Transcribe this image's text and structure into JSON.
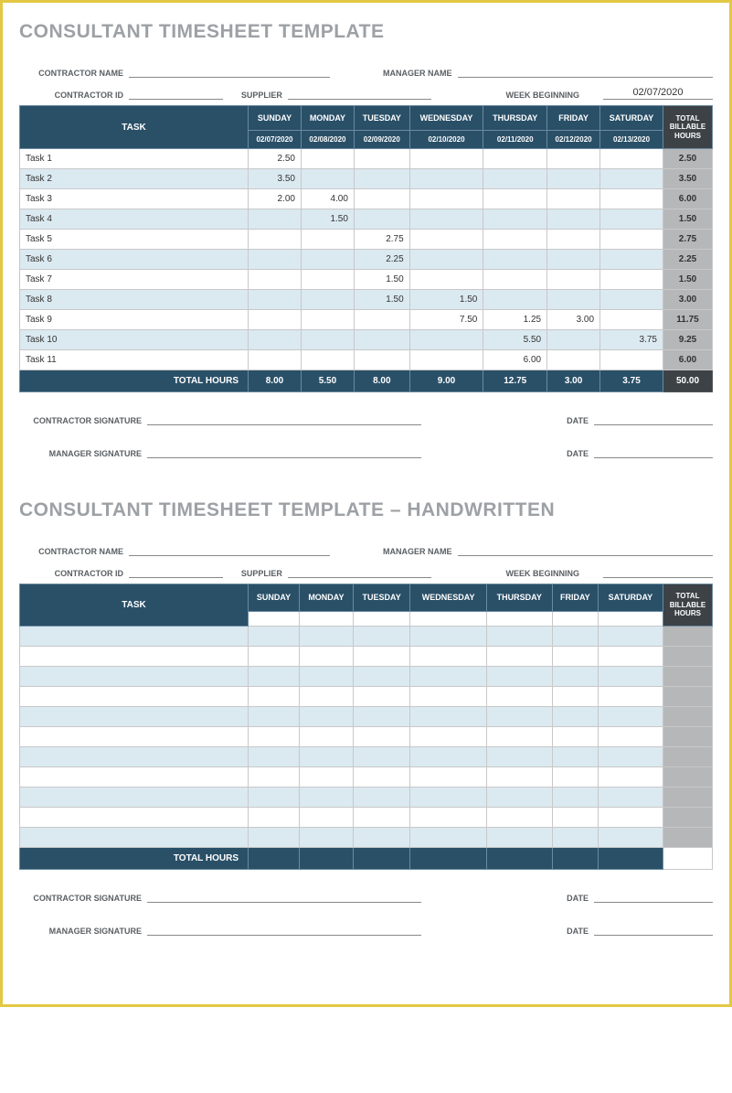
{
  "section1": {
    "title": "CONSULTANT TIMESHEET TEMPLATE",
    "labels": {
      "contractor_name": "CONTRACTOR NAME",
      "manager_name": "MANAGER NAME",
      "contractor_id": "CONTRACTOR ID",
      "supplier": "SUPPLIER",
      "week_beginning": "WEEK BEGINNING",
      "week_beginning_value": "02/07/2020",
      "contractor_signature": "CONTRACTOR SIGNATURE",
      "manager_signature": "MANAGER SIGNATURE",
      "date": "DATE"
    },
    "headers": {
      "task": "TASK",
      "days": [
        "SUNDAY",
        "MONDAY",
        "TUESDAY",
        "WEDNESDAY",
        "THURSDAY",
        "FRIDAY",
        "SATURDAY"
      ],
      "dates": [
        "02/07/2020",
        "02/08/2020",
        "02/09/2020",
        "02/10/2020",
        "02/11/2020",
        "02/12/2020",
        "02/13/2020"
      ],
      "total": "TOTAL BILLABLE HOURS"
    },
    "rows": [
      {
        "task": "Task 1",
        "vals": [
          "2.50",
          "",
          "",
          "",
          "",
          "",
          ""
        ],
        "total": "2.50"
      },
      {
        "task": "Task 2",
        "vals": [
          "3.50",
          "",
          "",
          "",
          "",
          "",
          ""
        ],
        "total": "3.50"
      },
      {
        "task": "Task 3",
        "vals": [
          "2.00",
          "4.00",
          "",
          "",
          "",
          "",
          ""
        ],
        "total": "6.00"
      },
      {
        "task": "Task 4",
        "vals": [
          "",
          "1.50",
          "",
          "",
          "",
          "",
          ""
        ],
        "total": "1.50"
      },
      {
        "task": "Task 5",
        "vals": [
          "",
          "",
          "2.75",
          "",
          "",
          "",
          ""
        ],
        "total": "2.75"
      },
      {
        "task": "Task 6",
        "vals": [
          "",
          "",
          "2.25",
          "",
          "",
          "",
          ""
        ],
        "total": "2.25"
      },
      {
        "task": "Task 7",
        "vals": [
          "",
          "",
          "1.50",
          "",
          "",
          "",
          ""
        ],
        "total": "1.50"
      },
      {
        "task": "Task 8",
        "vals": [
          "",
          "",
          "1.50",
          "1.50",
          "",
          "",
          ""
        ],
        "total": "3.00"
      },
      {
        "task": "Task 9",
        "vals": [
          "",
          "",
          "",
          "7.50",
          "1.25",
          "3.00",
          ""
        ],
        "total": "11.75"
      },
      {
        "task": "Task 10",
        "vals": [
          "",
          "",
          "",
          "",
          "5.50",
          "",
          "3.75"
        ],
        "total": "9.25"
      },
      {
        "task": "Task 11",
        "vals": [
          "",
          "",
          "",
          "",
          "6.00",
          "",
          ""
        ],
        "total": "6.00"
      }
    ],
    "footer": {
      "label": "TOTAL HOURS",
      "vals": [
        "8.00",
        "5.50",
        "8.00",
        "9.00",
        "12.75",
        "3.00",
        "3.75"
      ],
      "grand": "50.00"
    }
  },
  "section2": {
    "title": "CONSULTANT TIMESHEET TEMPLATE – HANDWRITTEN",
    "labels": {
      "contractor_name": "CONTRACTOR NAME",
      "manager_name": "MANAGER NAME",
      "contractor_id": "CONTRACTOR ID",
      "supplier": "SUPPLIER",
      "week_beginning": "WEEK BEGINNING",
      "contractor_signature": "CONTRACTOR SIGNATURE",
      "manager_signature": "MANAGER SIGNATURE",
      "date": "DATE"
    },
    "headers": {
      "task": "TASK",
      "days": [
        "SUNDAY",
        "MONDAY",
        "TUESDAY",
        "WEDNESDAY",
        "THURSDAY",
        "FRIDAY",
        "SATURDAY"
      ],
      "total": "TOTAL BILLABLE HOURS"
    },
    "blank_rows": 11,
    "footer": {
      "label": "TOTAL HOURS"
    }
  }
}
